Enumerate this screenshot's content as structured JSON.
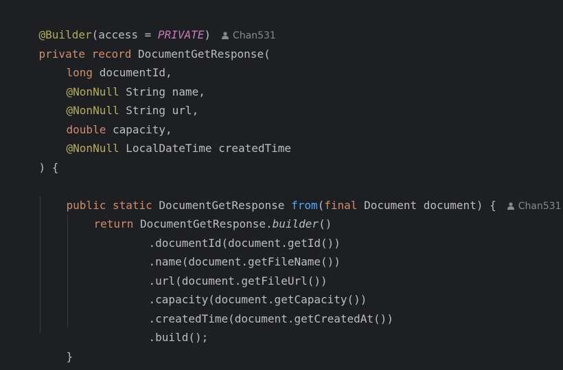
{
  "code": {
    "builder_annotation": "@Builder",
    "builder_paren_open": "(access = ",
    "builder_private": "PRIVATE",
    "builder_paren_close": ")",
    "author_1": "Chan531",
    "record_private": "private",
    "record_kw": "record",
    "record_name_open": "DocumentGetResponse(",
    "long_kw": "long",
    "document_id": "documentId,",
    "nonnull_1": "@NonNull",
    "name_field": "String name,",
    "nonnull_2": "@NonNull",
    "url_field": "String url,",
    "double_kw": "double",
    "capacity_field": "capacity,",
    "nonnull_3": "@NonNull",
    "created_field": "LocalDateTime createdTime",
    "record_close": ") {",
    "public_kw": "public",
    "static_kw": "static",
    "return_type": "DocumentGetResponse",
    "method_name": "from",
    "param_open": "(",
    "final_kw": "final",
    "param_rest": "Document document) {",
    "author_2": "Chan531",
    "return_kw": "return",
    "builder_call_prefix": "DocumentGetResponse.",
    "builder_call_italic": "builder",
    "builder_call_suffix": "()",
    "chain_1": ".documentId(document.getId())",
    "chain_2": ".name(document.getFileName())",
    "chain_3": ".url(document.getFileUrl())",
    "chain_4": ".capacity(document.getCapacity())",
    "chain_5": ".createdTime(document.getCreatedAt())",
    "chain_6": ".build();",
    "method_close": "}",
    "class_close": "}"
  },
  "colors": {
    "background": "#1e1f22",
    "keyword": "#cf8e6d",
    "annotation": "#b3ae60",
    "function": "#56a8f5",
    "enum_constant": "#c77dbb",
    "text": "#bcbec4",
    "author_hint": "#868a91"
  },
  "icons": {
    "author": "person-icon"
  }
}
